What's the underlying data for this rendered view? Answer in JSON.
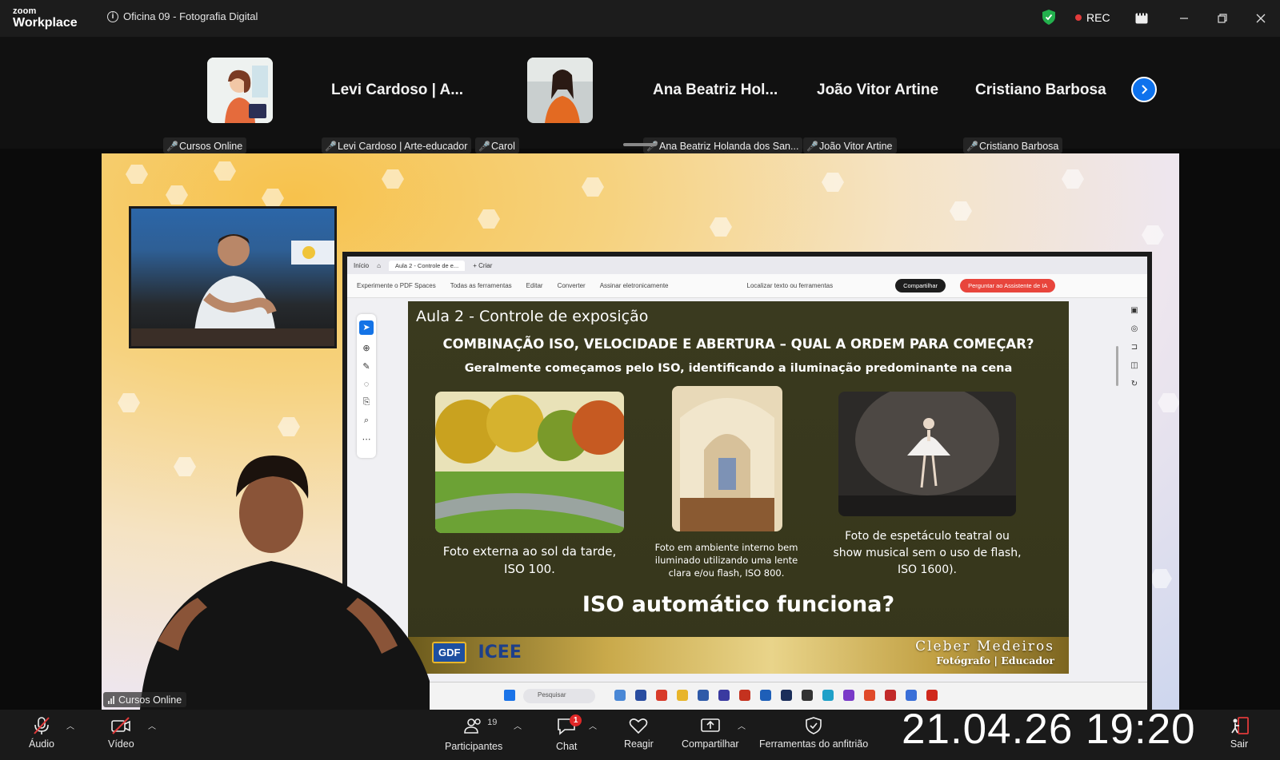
{
  "app": {
    "logo_top": "zoom",
    "logo_bottom": "Workplace",
    "meeting_title": "Oficina 09 - Fotografia Digital",
    "recording_label": "REC"
  },
  "participants": [
    {
      "name_label": "Cursos Online",
      "type": "avatar"
    },
    {
      "display_name": "Levi Cardoso | A...",
      "name_label": "Levi Cardoso | Arte-educador",
      "type": "name"
    },
    {
      "name_label": "Carol",
      "type": "photo"
    },
    {
      "display_name": "Ana Beatriz Hol...",
      "name_label": "Ana Beatriz Holanda dos San...",
      "type": "name"
    },
    {
      "display_name": "João Vitor Artine",
      "name_label": "João Vitor Artine",
      "type": "name"
    },
    {
      "display_name": "Cristiano Barbosa",
      "name_label": "Cristiano Barbosa",
      "type": "name"
    }
  ],
  "share": {
    "camera_label": "Cursos Online",
    "pdf": {
      "tab_home": "Início",
      "tab_doc": "Aula 2 - Controle de e...",
      "tab_new": "+ Criar",
      "toolbar_items": [
        "Experimente o PDF Spaces",
        "Todas as ferramentas",
        "Editar",
        "Converter",
        "Assinar eletronicamente"
      ],
      "search_hint": "Localizar texto ou ferramentas",
      "share_btn": "Compartilhar",
      "assistant_btn": "Perguntar ao Assistente de IA"
    },
    "slide": {
      "heading": "Aula 2 - Controle de exposição",
      "subtitle": "COMBINAÇÃO ISO, VELOCIDADE E ABERTURA – QUAL A ORDEM PARA COMEÇAR?",
      "subtitle2": "Geralmente começamos pelo ISO, identificando a iluminação predominante na cena",
      "captions": [
        "Foto externa ao sol da tarde, ISO 100.",
        "Foto em ambiente interno bem iluminado utilizando uma lente clara e/ou flash, ISO 800.",
        "Foto de espetáculo teatral ou show musical sem o uso de flash, ISO 1600)."
      ],
      "question": "ISO automático funciona?",
      "footer_logo_gdf": "GDF",
      "footer_logo_icee": "ICEE",
      "author_name": "Cleber Medeiros",
      "author_role": "Fotógrafo | Educador"
    },
    "taskbar_search": "Pesquisar"
  },
  "controls": {
    "audio": "Áudio",
    "video": "Vídeo",
    "participants": "Participantes",
    "participants_count": "19",
    "chat": "Chat",
    "chat_badge": "1",
    "react": "Reagir",
    "share": "Compartilhar",
    "host_tools": "Ferramentas do anfitrião",
    "leave": "Sair"
  },
  "overlay_timestamp": "21.04.26 19:20",
  "colors": {
    "accent": "#0e72ed",
    "rec": "#e23b3b",
    "slide_bg": "#3a3a1f",
    "assistant_btn": "#e8453c"
  }
}
